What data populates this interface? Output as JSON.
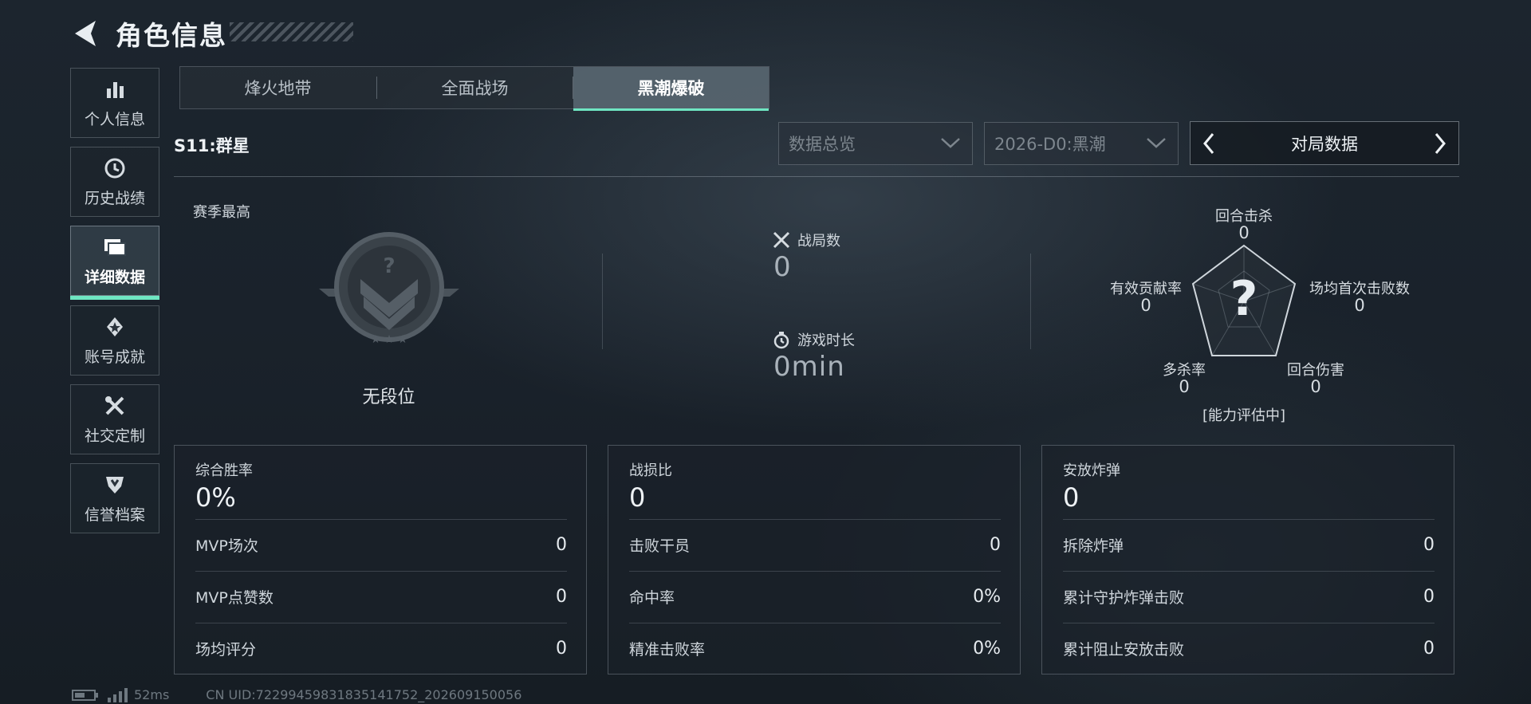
{
  "header": {
    "title": "角色信息"
  },
  "sidebar": {
    "items": [
      {
        "label": "个人信息",
        "icon": "bar-chart-icon"
      },
      {
        "label": "历史战绩",
        "icon": "history-clock-icon"
      },
      {
        "label": "详细数据",
        "icon": "folder-icon",
        "active": true
      },
      {
        "label": "账号成就",
        "icon": "medal-icon"
      },
      {
        "label": "社交定制",
        "icon": "tools-icon"
      },
      {
        "label": "信誉档案",
        "icon": "shield-badge-icon"
      }
    ]
  },
  "tabs": [
    {
      "label": "烽火地带"
    },
    {
      "label": "全面战场"
    },
    {
      "label": "黑潮爆破",
      "active": true
    }
  ],
  "season": "S11:群星",
  "filters": {
    "overview": "数据总览",
    "season_select": "2026-D0:黑潮",
    "match_data": "对局数据"
  },
  "rank": {
    "label": "赛季最高",
    "name": "无段位"
  },
  "summary": {
    "matches_label": "战局数",
    "matches_value": "0",
    "playtime_label": "游戏时长",
    "playtime_value": "0min"
  },
  "radar": {
    "top": {
      "label": "回合击杀",
      "value": "0"
    },
    "right": {
      "label": "场均首次击败数",
      "value": "0"
    },
    "bottom_right": {
      "label": "回合伤害",
      "value": "0"
    },
    "bottom_left": {
      "label": "多杀率",
      "value": "0"
    },
    "left": {
      "label": "有效贡献率",
      "value": "0"
    },
    "center_mark": "?",
    "status": "[能力评估中]"
  },
  "cards": [
    {
      "title": "综合胜率",
      "main": "0%",
      "rows": [
        {
          "label": "MVP场次",
          "value": "0"
        },
        {
          "label": "MVP点赞数",
          "value": "0"
        },
        {
          "label": "场均评分",
          "value": "0"
        }
      ]
    },
    {
      "title": "战损比",
      "main": "0",
      "rows": [
        {
          "label": "击败干员",
          "value": "0"
        },
        {
          "label": "命中率",
          "value": "0%"
        },
        {
          "label": "精准击败率",
          "value": "0%"
        }
      ]
    },
    {
      "title": "安放炸弹",
      "main": "0",
      "rows": [
        {
          "label": "拆除炸弹",
          "value": "0"
        },
        {
          "label": "累计守护炸弹击败",
          "value": "0"
        },
        {
          "label": "累计阻止安放击败",
          "value": "0"
        }
      ]
    }
  ],
  "footer": {
    "ping": "52ms",
    "uid": "CN UID:72299459831835141752_202609150056"
  },
  "colors": {
    "accent": "#6fe6c2"
  }
}
